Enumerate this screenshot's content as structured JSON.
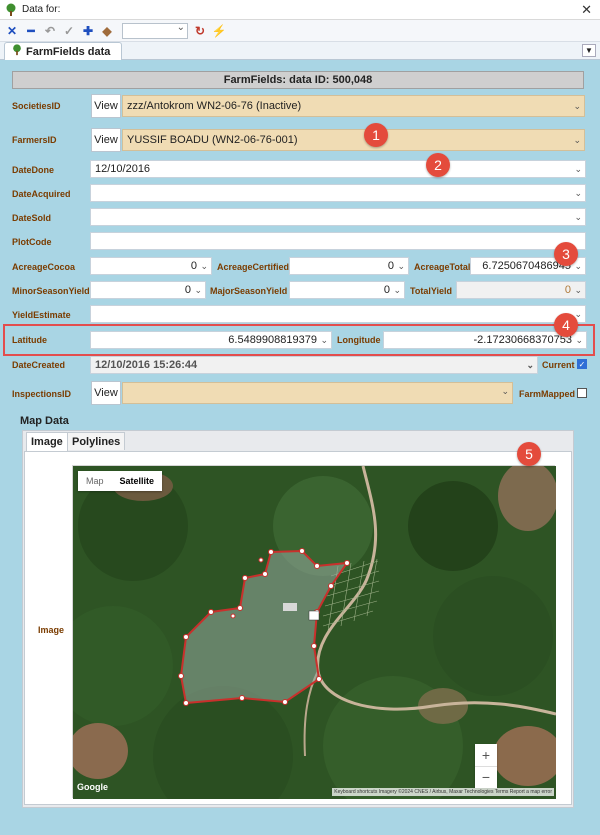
{
  "window": {
    "title": "Data for:"
  },
  "tab": {
    "label": "FarmFields data"
  },
  "header": {
    "title": "FarmFields: data ID: 500,048"
  },
  "view_label": "View",
  "fields": {
    "societies_id": {
      "label": "SocietiesID",
      "value": "zzz/Antokrom WN2-06-76 (Inactive)"
    },
    "farmers_id": {
      "label": "FarmersID",
      "value": "YUSSIF BOADU  (WN2-06-76-001)"
    },
    "date_done": {
      "label": "DateDone",
      "value": "12/10/2016"
    },
    "date_acquired": {
      "label": "DateAcquired",
      "value": ""
    },
    "date_sold": {
      "label": "DateSold",
      "value": ""
    },
    "plot_code": {
      "label": "PlotCode",
      "value": ""
    },
    "acreage_cocoa": {
      "label": "AcreageCocoa",
      "value": "0"
    },
    "acreage_certified": {
      "label": "AcreageCertified",
      "value": "0"
    },
    "acreage_total": {
      "label": "AcreageTotal",
      "value": "6.7250670486945"
    },
    "minor_season_yield": {
      "label": "MinorSeasonYield",
      "value": "0"
    },
    "major_season_yield": {
      "label": "MajorSeasonYield",
      "value": "0"
    },
    "total_yield": {
      "label": "TotalYield",
      "value": "0"
    },
    "yield_estimate": {
      "label": "YieldEstimate",
      "value": ""
    },
    "latitude": {
      "label": "Latitude",
      "value": "6.5489908819379"
    },
    "longitude": {
      "label": "Longitude",
      "value": "-2.17230668370753"
    },
    "date_created": {
      "label": "DateCreated",
      "value": "12/10/2016 15:26:44"
    },
    "current": {
      "label": "Current",
      "checked": true
    },
    "inspections_id": {
      "label": "InspectionsID",
      "value": ""
    },
    "farm_mapped": {
      "label": "FarmMapped",
      "checked": false
    }
  },
  "badges": [
    "1",
    "2",
    "3",
    "4",
    "5"
  ],
  "map_section": {
    "title": "Map Data",
    "tabs": [
      "Image",
      "Polylines"
    ],
    "image_label": "Image",
    "map_type_buttons": [
      "Map",
      "Satellite"
    ],
    "selected_map_type": "Satellite",
    "zoom_in": "+",
    "zoom_out": "−",
    "google_logo": "Google",
    "attribution": "Keyboard shortcuts   Imagery ©2024 CNES / Airbus, Maxar Technologies   Terms   Report a map error"
  },
  "colors": {
    "panel_bg": "#a9d5e4",
    "label": "#7a3c00",
    "tan_field": "#f0dcb4",
    "badge": "#e44b3c",
    "highlight": "#e34d4d",
    "polygon": "#c9302c"
  }
}
